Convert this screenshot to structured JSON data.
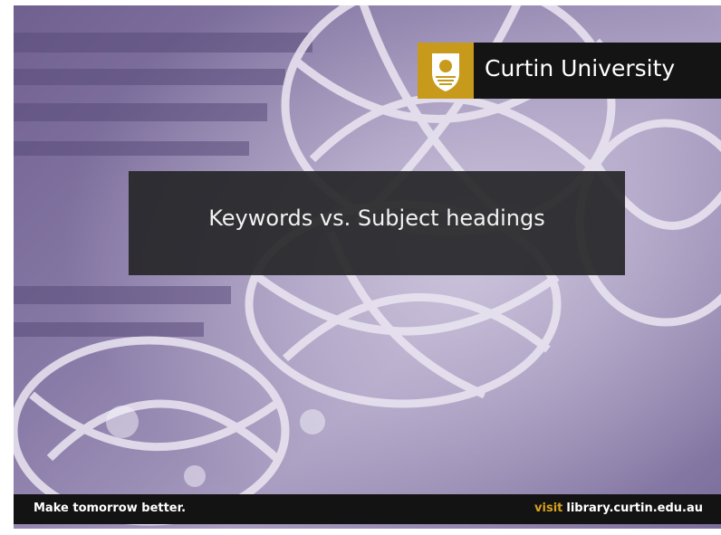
{
  "brand": {
    "name": "Curtin University",
    "logo_icon": "curtin-crest-icon",
    "logo_color": "#c79a1c"
  },
  "slide": {
    "title": "Keywords vs. Subject headings",
    "background_tint": "#7c6e9c"
  },
  "footer": {
    "tagline": "Make tomorrow better.",
    "visit_label": "visit",
    "url": "library.curtin.edu.au",
    "accent_color": "#d6a11c"
  }
}
